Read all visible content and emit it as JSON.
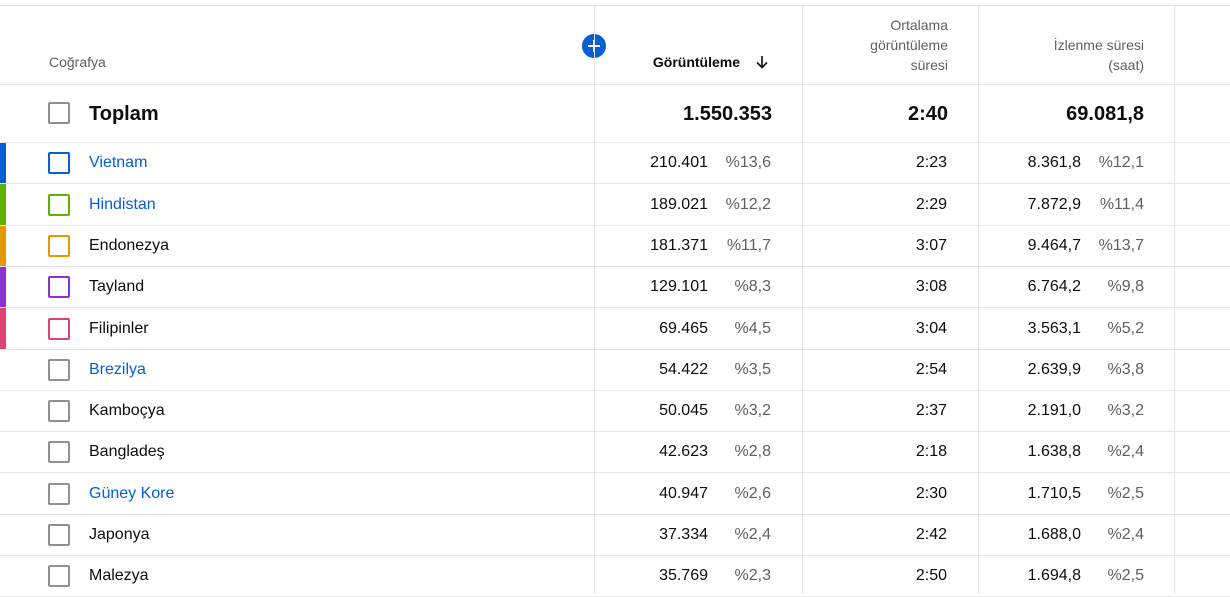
{
  "header": {
    "geo_label": "Coğrafya",
    "views_label": "Görüntüleme",
    "avg_label_line1": "Ortalama",
    "avg_label_line2": "görüntüleme",
    "avg_label_line3": "süresi",
    "watch_label_line1": "İzlenme süresi",
    "watch_label_line2": "(saat)",
    "add_icon": "plus-circle-icon",
    "sort_icon": "arrow-down-icon"
  },
  "total": {
    "label": "Toplam",
    "views": "1.550.353",
    "avg": "2:40",
    "watch": "69.081,8"
  },
  "rows": [
    {
      "name": "Vietnam",
      "link": true,
      "color": "#065fd4",
      "views": "210.401",
      "views_pct": "%13,6",
      "avg": "2:23",
      "watch": "8.361,8",
      "watch_pct": "%12,1"
    },
    {
      "name": "Hindistan",
      "link": true,
      "color": "#5eb100",
      "views": "189.021",
      "views_pct": "%12,2",
      "avg": "2:29",
      "watch": "7.872,9",
      "watch_pct": "%11,4"
    },
    {
      "name": "Endonezya",
      "link": false,
      "color": "#e39a00",
      "views": "181.371",
      "views_pct": "%11,7",
      "avg": "3:07",
      "watch": "9.464,7",
      "watch_pct": "%13,7"
    },
    {
      "name": "Tayland",
      "link": false,
      "color": "#8d32d1",
      "views": "129.101",
      "views_pct": "%8,3",
      "avg": "3:08",
      "watch": "6.764,2",
      "watch_pct": "%9,8"
    },
    {
      "name": "Filipinler",
      "link": false,
      "color": "#e0436f",
      "views": "69.465",
      "views_pct": "%4,5",
      "avg": "3:04",
      "watch": "3.563,1",
      "watch_pct": "%5,2"
    },
    {
      "name": "Brezilya",
      "link": true,
      "color": "",
      "views": "54.422",
      "views_pct": "%3,5",
      "avg": "2:54",
      "watch": "2.639,9",
      "watch_pct": "%3,8"
    },
    {
      "name": "Kamboçya",
      "link": false,
      "color": "",
      "views": "50.045",
      "views_pct": "%3,2",
      "avg": "2:37",
      "watch": "2.191,0",
      "watch_pct": "%3,2"
    },
    {
      "name": "Bangladeş",
      "link": false,
      "color": "",
      "views": "42.623",
      "views_pct": "%2,8",
      "avg": "2:18",
      "watch": "1.638,8",
      "watch_pct": "%2,4"
    },
    {
      "name": "Güney Kore",
      "link": true,
      "color": "",
      "views": "40.947",
      "views_pct": "%2,6",
      "avg": "2:30",
      "watch": "1.710,5",
      "watch_pct": "%2,5"
    },
    {
      "name": "Japonya",
      "link": false,
      "color": "",
      "views": "37.334",
      "views_pct": "%2,4",
      "avg": "2:42",
      "watch": "1.688,0",
      "watch_pct": "%2,4"
    },
    {
      "name": "Malezya",
      "link": false,
      "color": "",
      "views": "35.769",
      "views_pct": "%2,3",
      "avg": "2:50",
      "watch": "1.694,8",
      "watch_pct": "%2,5"
    }
  ]
}
